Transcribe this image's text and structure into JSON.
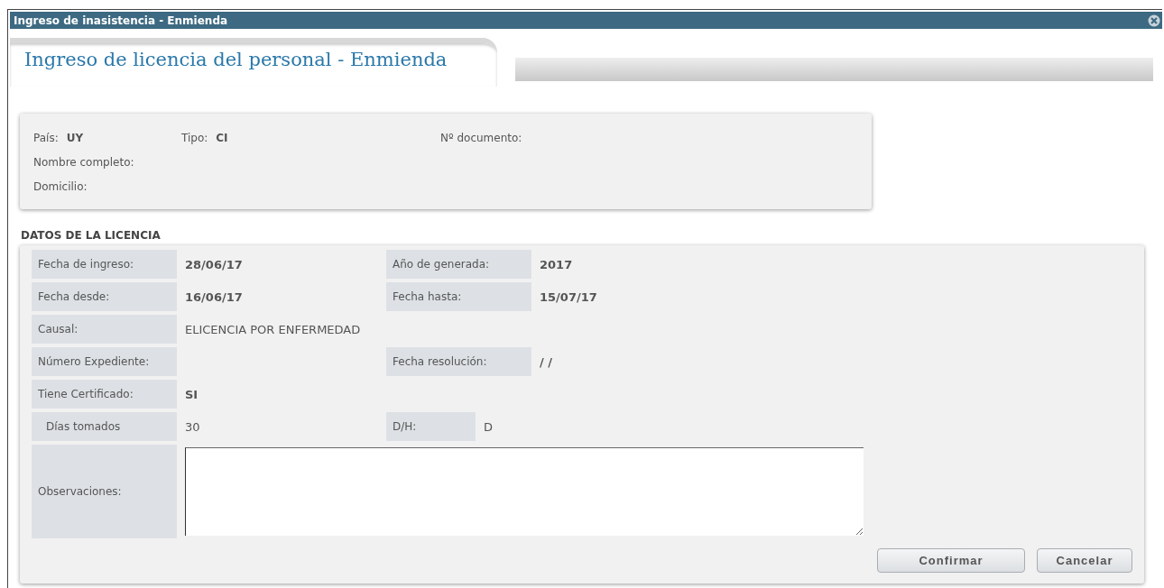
{
  "window": {
    "title": "Ingreso de inasistencia - Enmienda"
  },
  "header": {
    "title": "Ingreso de licencia del personal - Enmienda"
  },
  "person": {
    "lines": [
      {
        "fields": [
          {
            "label": "País:",
            "value": "UY"
          },
          {
            "label": "Tipo:",
            "value": "CI"
          },
          {
            "label": "Nº documento:"
          }
        ]
      },
      {
        "fields": [
          {
            "label": "Nombre completo:"
          }
        ]
      },
      {
        "fields": [
          {
            "label": "Domicilio:"
          }
        ]
      }
    ]
  },
  "section_title": "DATOS DE LA LICENCIA",
  "rows": [
    {
      "fields": [
        {
          "label": "Fecha de ingreso:",
          "value": "28/06/17",
          "bold": true,
          "kind": "normal"
        },
        {
          "label": "Año de generada:",
          "value": "2017",
          "bold": true,
          "kind": "normal"
        }
      ]
    },
    {
      "fields": [
        {
          "label": "Fecha desde:",
          "value": "16/06/17",
          "bold": true,
          "kind": "normal"
        },
        {
          "label": "Fecha hasta:",
          "value": "15/07/17",
          "bold": true,
          "kind": "normal"
        }
      ]
    },
    {
      "fields": [
        {
          "label": "Causal:",
          "value": "ELICENCIA POR ENFERMEDAD",
          "bold": false,
          "kind": "normal"
        }
      ]
    },
    {
      "fields": [
        {
          "label": "Número Expediente:",
          "kind": "normal"
        },
        {
          "label": "Fecha resolución:",
          "value": "/ /",
          "bold": true,
          "kind": "normal"
        }
      ]
    },
    {
      "fields": [
        {
          "label": "Tiene Certificado:",
          "value": "SI",
          "bold": true,
          "kind": "normal"
        }
      ]
    },
    {
      "fields": [
        {
          "label": "Días tomados",
          "value": "30",
          "bold": false,
          "kind": "indented"
        },
        {
          "label": "D/H:",
          "value": "D",
          "bold": false,
          "kind": "short"
        }
      ]
    }
  ],
  "observations": {
    "label": "Observaciones:"
  },
  "buttons": [
    {
      "label": "Confirmar"
    },
    {
      "label": "Cancelar"
    }
  ]
}
